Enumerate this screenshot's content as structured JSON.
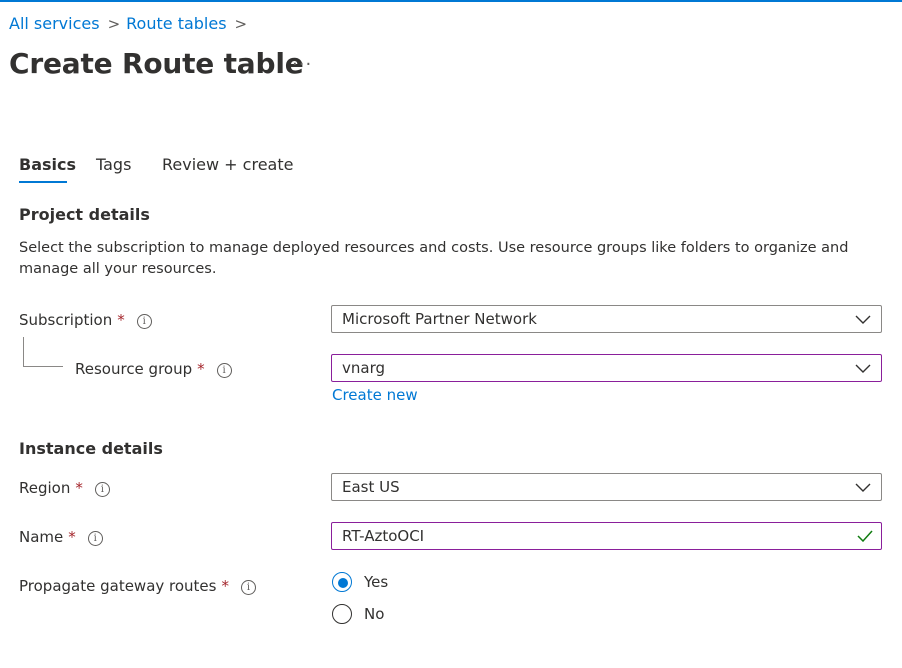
{
  "breadcrumb": {
    "items": [
      "All services",
      "Route tables"
    ],
    "separator": ">"
  },
  "page": {
    "title": "Create Route table",
    "more_label": "···"
  },
  "tabs": [
    {
      "label": "Basics",
      "active": true
    },
    {
      "label": "Tags",
      "active": false
    },
    {
      "label": "Review + create",
      "active": false
    }
  ],
  "project_details": {
    "heading": "Project details",
    "description": "Select the subscription to manage deployed resources and costs. Use resource groups like folders to organize and manage all your resources.",
    "subscription": {
      "label": "Subscription",
      "value": "Microsoft Partner Network"
    },
    "resource_group": {
      "label": "Resource group",
      "value": "vnarg",
      "create_new": "Create new"
    }
  },
  "instance_details": {
    "heading": "Instance details",
    "region": {
      "label": "Region",
      "value": "East US"
    },
    "name": {
      "label": "Name",
      "value": "RT-AztoOCI"
    },
    "propagate": {
      "label": "Propagate gateway routes",
      "options": [
        {
          "label": "Yes",
          "selected": true
        },
        {
          "label": "No",
          "selected": false
        }
      ]
    }
  },
  "markers": {
    "required": "*",
    "info": "i"
  },
  "colors": {
    "accent": "#0078d4",
    "focus_border": "#8a1f9b",
    "required": "#a4262c",
    "valid": "#107c10"
  }
}
